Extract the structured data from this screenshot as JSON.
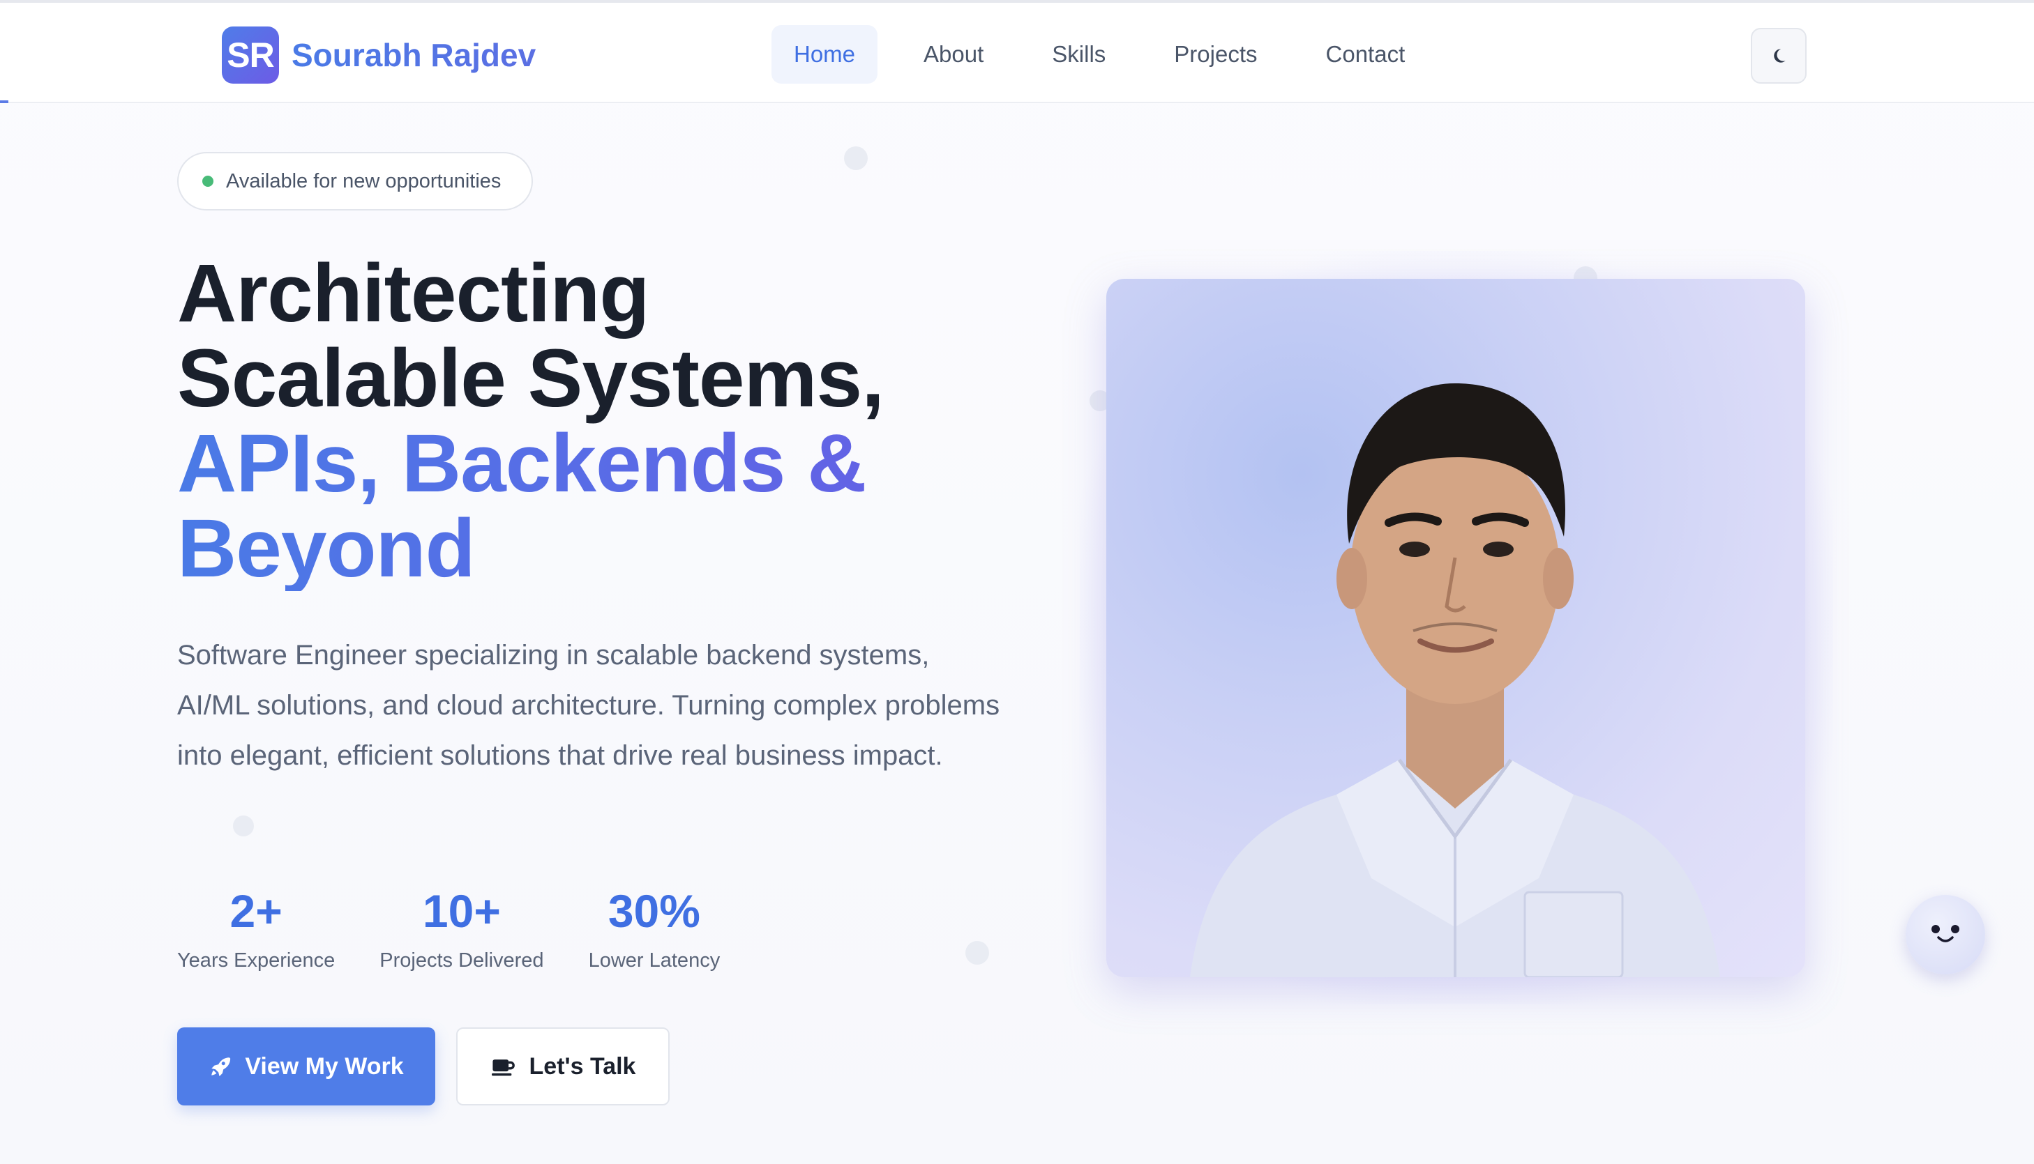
{
  "nav": {
    "logo_initials": "SR",
    "brand_name": "Sourabh Rajdev",
    "links": [
      {
        "label": "Home",
        "active": true
      },
      {
        "label": "About",
        "active": false
      },
      {
        "label": "Skills",
        "active": false
      },
      {
        "label": "Projects",
        "active": false
      },
      {
        "label": "Contact",
        "active": false
      }
    ],
    "theme_toggle_icon": "moon-icon"
  },
  "hero": {
    "badge_text": "Available for new opportunities",
    "headline_lines": [
      "Architecting",
      "Scalable Systems,",
      "APIs, Backends &",
      "Beyond"
    ],
    "description": "Software Engineer specializing in scalable backend systems, AI/ML solutions, and cloud architecture. Turning complex problems into elegant, efficient solutions that drive real business impact.",
    "stats": [
      {
        "value": "2+",
        "label": "Years Experience"
      },
      {
        "value": "10+",
        "label": "Projects Delivered"
      },
      {
        "value": "30%",
        "label": "Lower Latency"
      }
    ],
    "primary_button": "View My Work",
    "secondary_button": "Let's Talk",
    "primary_button_icon": "rocket-icon",
    "secondary_button_icon": "coffee-icon"
  },
  "chat_widget_icon": "smile-icon",
  "colors": {
    "accent": "#4f7de8",
    "accent_purple": "#6a5be5",
    "dark_text": "#1a202c",
    "muted_text": "#5a6478",
    "status_green": "#48bb78"
  }
}
